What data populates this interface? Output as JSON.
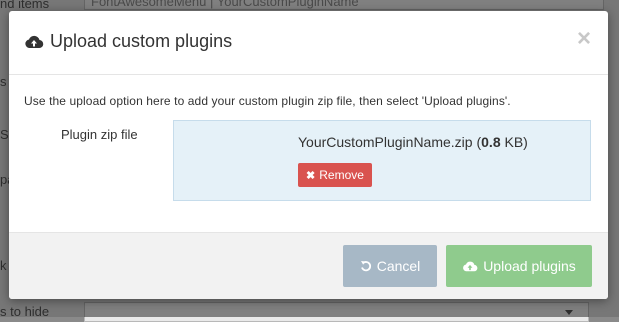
{
  "background": {
    "top_input_text": "FontAwesomeMenu | YourCustomPluginName",
    "left_fragments": [
      "nd items",
      "s",
      "S",
      "pa",
      "k",
      "s to hide"
    ]
  },
  "modal": {
    "title": "Upload custom plugins",
    "title_icon": "cloud-upload-icon",
    "close_symbol": "×",
    "intro": "Use the upload option here to add your custom plugin zip file, then select 'Upload plugins'.",
    "field_label": "Plugin zip file",
    "file": {
      "name": "YourCustomPluginName.zip",
      "size_open": " (",
      "size_value": "0.8",
      "size_unit": " KB)"
    },
    "remove_label": "Remove",
    "cancel_label": "Cancel",
    "upload_label": "Upload plugins"
  },
  "colors": {
    "remove": "#d9534f",
    "cancel": "#a7b8c6",
    "upload": "#8fcb8d",
    "dropzone": "#e5f1f8"
  }
}
